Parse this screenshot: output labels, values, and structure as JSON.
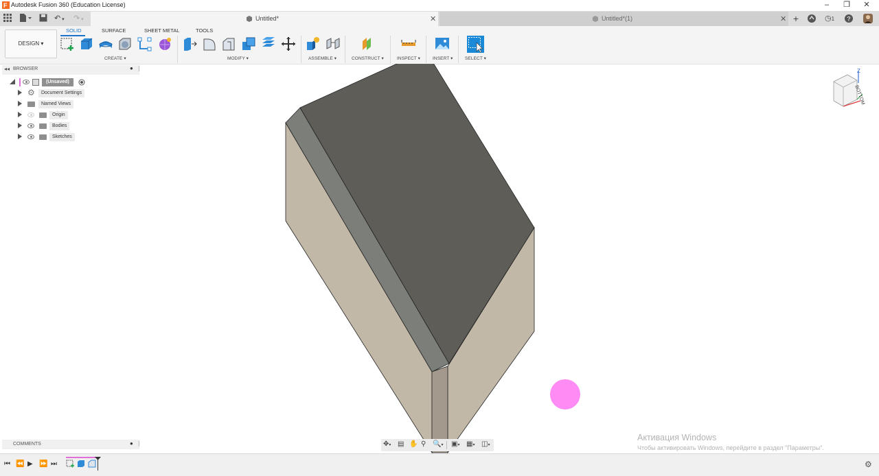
{
  "window": {
    "title": "Autodesk Fusion 360 (Education License)"
  },
  "tabs": [
    {
      "label": "Untitled*",
      "active": true
    },
    {
      "label": "Untitled*(1)",
      "active": false
    }
  ],
  "notifications": {
    "count": "1"
  },
  "workspace": {
    "label": "DESIGN ▾"
  },
  "toolbar_tabs": [
    "SOLID",
    "SURFACE",
    "SHEET METAL",
    "TOOLS"
  ],
  "groups": {
    "create": "CREATE ▾",
    "modify": "MODIFY ▾",
    "assemble": "ASSEMBLE ▾",
    "construct": "CONSTRUCT ▾",
    "inspect": "INSPECT ▾",
    "insert": "INSERT ▾",
    "select": "SELECT ▾"
  },
  "browser": {
    "title": "BROWSER",
    "root": "(Unsaved)",
    "items": [
      {
        "label": "Document Settings",
        "icon": "gear-icon"
      },
      {
        "label": "Named Views",
        "icon": "folder-icon"
      },
      {
        "label": "Origin",
        "icon": "folder-icon",
        "visible": false
      },
      {
        "label": "Bodies",
        "icon": "folder-icon",
        "visible": true
      },
      {
        "label": "Sketches",
        "icon": "folder-icon",
        "visible": true
      }
    ]
  },
  "viewcube": {
    "face": "BOTTOM",
    "axis": "Z"
  },
  "comments": {
    "title": "COMMENTS"
  },
  "watermark": {
    "line1": "Активация Windows",
    "line2": "Чтобы активировать Windows, перейдите в раздел \"Параметры\"."
  },
  "colors": {
    "accent": "#1a73c9",
    "top_face": "#5e5d58",
    "side_face": "#c2b8a8",
    "chamfer_face": "#7b7e79",
    "edge_face": "#a39a8d",
    "cursor_dot": "#ff8cf5"
  }
}
